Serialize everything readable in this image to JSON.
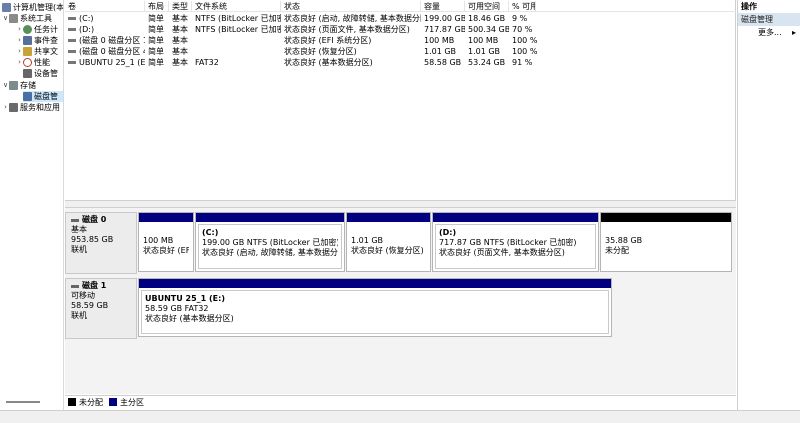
{
  "tree": {
    "items": [
      {
        "label": "计算机管理(本",
        "chevron": "",
        "icon_color": "#6a7fa8"
      },
      {
        "label": "系统工具",
        "chevron": "∨",
        "icon_color": "#8a8a8a"
      },
      {
        "label": "任务计",
        "chevron": "›",
        "icon_color": "#5a8f5a"
      },
      {
        "label": "事件查",
        "chevron": "›",
        "icon_color": "#5a6e9a"
      },
      {
        "label": "共享文",
        "chevron": "›",
        "icon_color": "#c9a13b"
      },
      {
        "label": "性能",
        "chevron": "›",
        "icon_color": "#c0392b"
      },
      {
        "label": "设备管",
        "chevron": "",
        "icon_color": "#666666"
      },
      {
        "label": "存储",
        "chevron": "∨",
        "icon_color": "#7f8c8d"
      },
      {
        "label": "磁盘管",
        "chevron": "",
        "icon_color": "#4a6fa5"
      },
      {
        "label": "服务和应用",
        "chevron": "›",
        "icon_color": "#6a6a6a"
      }
    ]
  },
  "table": {
    "headers": [
      "卷",
      "布局",
      "类型",
      "文件系统",
      "状态",
      "容量",
      "可用空间",
      "% 可用"
    ],
    "rows": [
      [
        "(C:)",
        "简单",
        "基本",
        "NTFS (BitLocker 已加密)",
        "状态良好 (启动, 故障转储, 基本数据分区)",
        "199.00 GB",
        "18.46 GB",
        "9 %"
      ],
      [
        "(D:)",
        "简单",
        "基本",
        "NTFS (BitLocker 已加密)",
        "状态良好 (页面文件, 基本数据分区)",
        "717.87 GB",
        "500.34 GB",
        "70 %"
      ],
      [
        "(磁盘 0 磁盘分区 1)",
        "简单",
        "基本",
        "",
        "状态良好 (EFI 系统分区)",
        "100 MB",
        "100 MB",
        "100 %"
      ],
      [
        "(磁盘 0 磁盘分区 4)",
        "简单",
        "基本",
        "",
        "状态良好 (恢复分区)",
        "1.01 GB",
        "1.01 GB",
        "100 %"
      ],
      [
        "UBUNTU 25_1 (E:)",
        "简单",
        "基本",
        "FAT32",
        "状态良好 (基本数据分区)",
        "58.58 GB",
        "53.24 GB",
        "91 %"
      ]
    ]
  },
  "disks": {
    "disk0": {
      "name": "磁盘 0",
      "type": "基本",
      "size": "953.85 GB",
      "status": "联机",
      "parts": [
        {
          "title": "",
          "line1": "100 MB",
          "line2": "状态良好 (EFI 系"
        },
        {
          "title": "(C:)",
          "line1": "199.00 GB NTFS (BitLocker 已加密)",
          "line2": "状态良好 (启动, 故障转储, 基本数据分区)"
        },
        {
          "title": "",
          "line1": "1.01 GB",
          "line2": "状态良好 (恢复分区)"
        },
        {
          "title": "(D:)",
          "line1": "717.87 GB NTFS (BitLocker 已加密)",
          "line2": "状态良好 (页面文件, 基本数据分区)"
        },
        {
          "title": "",
          "line1": "35.88 GB",
          "line2": "未分配"
        }
      ]
    },
    "disk1": {
      "name": "磁盘 1",
      "type": "可移动",
      "size": "58.59 GB",
      "status": "联机",
      "parts": [
        {
          "title": "UBUNTU 25_1  (E:)",
          "line1": "58.59 GB FAT32",
          "line2": "状态良好 (基本数据分区)"
        }
      ]
    }
  },
  "legend": {
    "items": [
      {
        "label": "未分配",
        "color": "#000000"
      },
      {
        "label": "主分区",
        "color": "#000080"
      }
    ]
  },
  "actions": {
    "header": "操作",
    "section": "磁盘管理",
    "more": "更多...",
    "more_arrow": "▸"
  },
  "colors": {
    "primary_partition": "#000080",
    "unallocated": "#000000"
  }
}
